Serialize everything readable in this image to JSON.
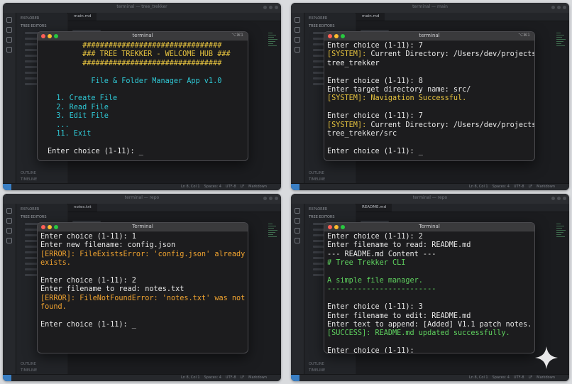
{
  "background": {
    "panel_titles": [
      "terminal — tree_trekker",
      "terminal — main",
      "terminal — repo",
      "terminal — repo"
    ],
    "explorer_header": "EXPLORER",
    "explorer_section": "TREE EDITORS",
    "outline_label": "OUTLINE",
    "timeline_label": "TIMELINE",
    "tabs": [
      "main.md",
      "main.md",
      "notes.txt",
      "README.md"
    ],
    "status_items": [
      "Ln 8, Col 1",
      "Spaces: 4",
      "UTF-8",
      "LF",
      "Markdown"
    ]
  },
  "terminals": [
    {
      "title": "terminal",
      "shortcut": "⌥⌘1",
      "lines": [
        {
          "text": "        ################################",
          "color": "yellow"
        },
        {
          "text": "        ### TREE TREKKER - WELCOME HUB ###",
          "color": "yellow"
        },
        {
          "text": "        ################################",
          "color": "yellow"
        },
        {
          "text": "",
          "color": "white"
        },
        {
          "text": "          File & Folder Manager App v1.0",
          "color": "cyan"
        },
        {
          "text": "",
          "color": "white"
        },
        {
          "text": "  1. Create File",
          "color": "cyan"
        },
        {
          "text": "  2. Read File",
          "color": "cyan"
        },
        {
          "text": "  3. Edit File",
          "color": "cyan"
        },
        {
          "text": "  ...",
          "color": "cyan"
        },
        {
          "text": "  11. Exit",
          "color": "cyan"
        },
        {
          "text": "",
          "color": "white"
        },
        {
          "text": "Enter choice (1-11): _",
          "color": "white"
        }
      ]
    },
    {
      "title": "terminal",
      "shortcut": "⌥⌘1",
      "lines": [
        {
          "text": "Enter choice (1-11): 7",
          "color": "white"
        },
        {
          "text": "[SYSTEM]: Current Directory: /Users/dev/projects/",
          "color": "mixed",
          "prefix": "[SYSTEM]:",
          "rest": " Current Directory: /Users/dev/projects/"
        },
        {
          "text": "tree_trekker",
          "color": "white"
        },
        {
          "text": "",
          "color": "white"
        },
        {
          "text": "Enter choice (1-11): 8",
          "color": "white"
        },
        {
          "text": "Enter target directory name: src/",
          "color": "white"
        },
        {
          "text": "[SYSTEM]: Navigation Successful.",
          "color": "yellow"
        },
        {
          "text": "",
          "color": "white"
        },
        {
          "text": "Enter choice (1-11): 7",
          "color": "white"
        },
        {
          "text": "[SYSTEM]: Current Directory: /Users/dev/projects/",
          "color": "mixed",
          "prefix": "[SYSTEM]:",
          "rest": " Current Directory: /Users/dev/projects/"
        },
        {
          "text": "tree_trekker/src",
          "color": "white"
        },
        {
          "text": "",
          "color": "white"
        },
        {
          "text": "Enter choice (1-11): _",
          "color": "white"
        }
      ]
    },
    {
      "title": "Terminal",
      "shortcut": "",
      "lines": [
        {
          "text": "Enter choice (1-11): 1",
          "color": "white"
        },
        {
          "text": "Enter new filename: config.json",
          "color": "white"
        },
        {
          "text": "[ERROR]: FileExistsError: 'config.json' already",
          "color": "orange"
        },
        {
          "text": "exists.",
          "color": "orange"
        },
        {
          "text": "",
          "color": "white"
        },
        {
          "text": "Enter choice (1-11): 2",
          "color": "white"
        },
        {
          "text": "Enter filename to read: notes.txt",
          "color": "white"
        },
        {
          "text": "[ERROR]: FileNotFoundError: 'notes.txt' was not",
          "color": "orange"
        },
        {
          "text": "found.",
          "color": "orange"
        },
        {
          "text": "",
          "color": "white"
        },
        {
          "text": "Enter choice (1-11): _",
          "color": "white"
        }
      ]
    },
    {
      "title": "Terminal",
      "shortcut": "",
      "lines": [
        {
          "text": "Enter choice (1-11): 2",
          "color": "white"
        },
        {
          "text": "Enter filename to read: README.md",
          "color": "white"
        },
        {
          "text": "--- README.md Content ---",
          "color": "white"
        },
        {
          "text": "# Tree Trekker CLI",
          "color": "green"
        },
        {
          "text": "",
          "color": "white"
        },
        {
          "text": "A simple file manager.",
          "color": "green"
        },
        {
          "text": "-------------------------",
          "color": "green"
        },
        {
          "text": "",
          "color": "white"
        },
        {
          "text": "Enter choice (1-11): 3",
          "color": "white"
        },
        {
          "text": "Enter filename to edit: README.md",
          "color": "white"
        },
        {
          "text": "Enter text to append: [Added] V1.1 patch notes.",
          "color": "white"
        },
        {
          "text": "[SUCCESS]: README.md updated successfully.",
          "color": "green"
        },
        {
          "text": "",
          "color": "white"
        },
        {
          "text": "Enter choice (1-11): _",
          "color": "white"
        }
      ]
    }
  ],
  "colors": {
    "white": "#e8e8e8",
    "yellow": "#e5c23f",
    "orange": "#f0a330",
    "green": "#5fd35f",
    "cyan": "#2fc9d6",
    "accent": "#3a7fc4"
  },
  "icons": [
    "sparkle-icon",
    "files-icon",
    "search-icon",
    "source-control-icon",
    "extensions-icon"
  ]
}
